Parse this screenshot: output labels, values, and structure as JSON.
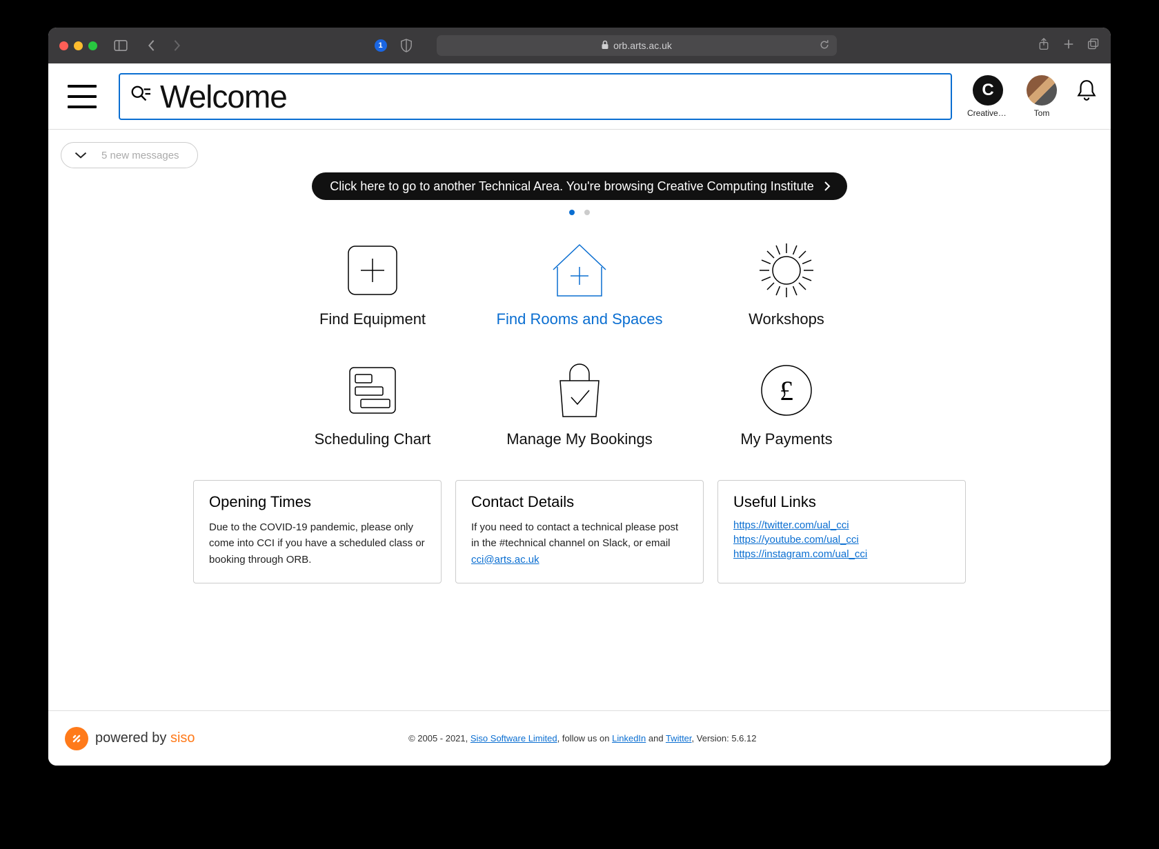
{
  "browser": {
    "url": "orb.arts.ac.uk"
  },
  "header": {
    "search_text": "Welcome",
    "users": [
      {
        "initial": "C",
        "label": "Creative …"
      },
      {
        "label": "Tom"
      }
    ]
  },
  "messages_pill": "5 new messages",
  "banner": "Click here to go to another Technical Area. You're browsing Creative Computing Institute",
  "carousel": {
    "count": 2,
    "active": 0
  },
  "tiles": [
    {
      "label": "Find Equipment",
      "icon": "plus-box"
    },
    {
      "label": "Find Rooms and Spaces",
      "icon": "house-plus",
      "active": true
    },
    {
      "label": "Workshops",
      "icon": "gear"
    },
    {
      "label": "Scheduling Chart",
      "icon": "form"
    },
    {
      "label": "Manage My Bookings",
      "icon": "bag-check"
    },
    {
      "label": "My Payments",
      "icon": "pound-circle"
    }
  ],
  "cards": {
    "opening": {
      "title": "Opening Times",
      "body": "Due to the COVID-19 pandemic, please only come into CCI if you have a scheduled class or booking through ORB."
    },
    "contact": {
      "title": "Contact Details",
      "body": "If you need to contact a technical please post in the #technical channel on Slack, or email ",
      "email": "cci@arts.ac.uk"
    },
    "links": {
      "title": "Useful Links",
      "items": [
        "https://twitter.com/ual_cci",
        "https://youtube.com/ual_cci",
        "https://instagram.com/ual_cci"
      ]
    }
  },
  "footer": {
    "powered_prefix": "powered by ",
    "powered_brand": "siso",
    "copy_prefix": "© 2005 - 2021, ",
    "siso_link": "Siso Software Limited",
    "follow": ", follow us on ",
    "linkedin": "LinkedIn",
    "and": " and ",
    "twitter": "Twitter",
    "version": ", Version: 5.6.12"
  }
}
